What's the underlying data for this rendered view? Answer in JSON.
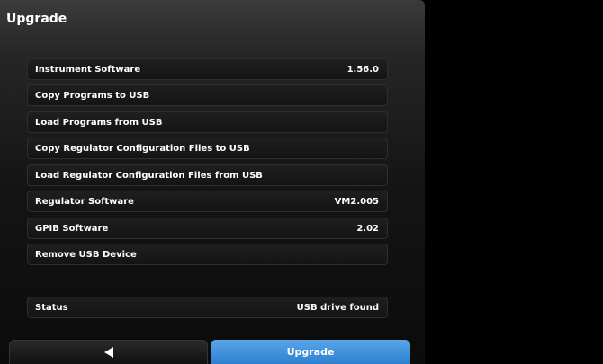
{
  "screen": {
    "title": "Upgrade"
  },
  "rows": [
    {
      "label": "Instrument Software",
      "value": "1.56.0"
    },
    {
      "label": "Copy Programs to USB",
      "value": ""
    },
    {
      "label": "Load Programs from USB",
      "value": ""
    },
    {
      "label": "Copy Regulator Configuration Files to USB",
      "value": ""
    },
    {
      "label": "Load Regulator Configuration Files from USB",
      "value": ""
    },
    {
      "label": "Regulator Software",
      "value": "VM2.005"
    },
    {
      "label": "GPIB Software",
      "value": "2.02"
    },
    {
      "label": "Remove USB Device",
      "value": ""
    }
  ],
  "status": {
    "label": "Status",
    "value": "USB drive found"
  },
  "footer": {
    "back_icon": "back-arrow-icon",
    "upgrade_label": "Upgrade"
  }
}
